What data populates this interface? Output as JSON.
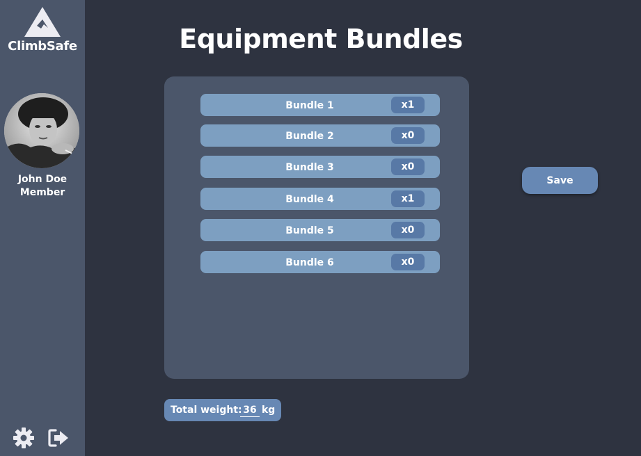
{
  "sidebar": {
    "brand": "ClimbSafe",
    "user": {
      "name": "John Doe",
      "role": "Member"
    },
    "icons": {
      "logo": "mountain-icon",
      "settings": "gear-icon",
      "logout": "sign-out-icon"
    }
  },
  "main": {
    "title": "Equipment Bundles",
    "bundles": [
      {
        "label": "Bundle 1",
        "qty": "x1"
      },
      {
        "label": "Bundle 2",
        "qty": "x0"
      },
      {
        "label": "Bundle 3",
        "qty": "x0"
      },
      {
        "label": "Bundle 4",
        "qty": "x1"
      },
      {
        "label": "Bundle 5",
        "qty": "x0"
      },
      {
        "label": "Bundle 6",
        "qty": "x0"
      }
    ],
    "save_label": "Save",
    "total_weight": {
      "label": "Total weight:",
      "value": "36",
      "unit": "kg"
    }
  },
  "colors": {
    "background": "#2e3340",
    "sidebar": "#4b566a",
    "panel": "#4b566a",
    "bundle_row": "#7d9fc1",
    "qty_badge": "#5879a6",
    "button": "#6788b4",
    "text": "#ffffff"
  }
}
